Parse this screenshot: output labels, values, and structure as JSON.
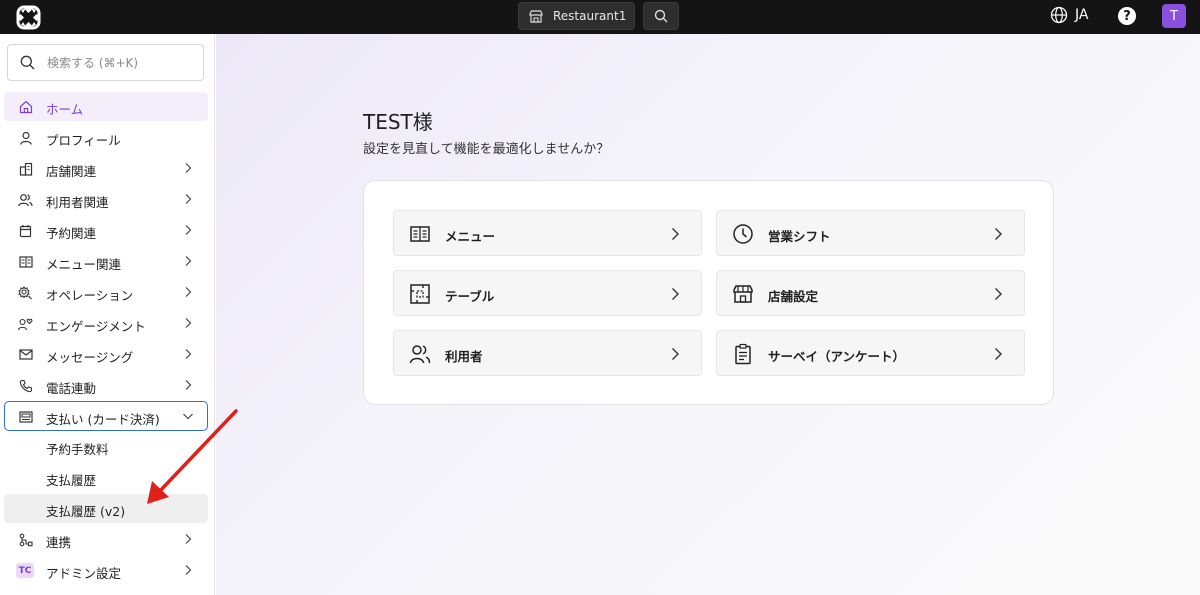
{
  "topbar": {
    "store_name": "Restaurant1",
    "language": "JA",
    "help_symbol": "?",
    "avatar_initial": "T"
  },
  "sidebar": {
    "search_placeholder": "検索する (⌘+K)",
    "items": [
      {
        "label": "ホーム",
        "icon": "home-icon",
        "chevron": false
      },
      {
        "label": "プロフィール",
        "icon": "person-icon",
        "chevron": false
      },
      {
        "label": "店舗関連",
        "icon": "building-icon",
        "chevron": true
      },
      {
        "label": "利用者関連",
        "icon": "users-icon",
        "chevron": true
      },
      {
        "label": "予約関連",
        "icon": "calendar-icon",
        "chevron": true
      },
      {
        "label": "メニュー関連",
        "icon": "menu-book-icon",
        "chevron": true
      },
      {
        "label": "オペレーション",
        "icon": "operation-gear-icon",
        "chevron": true
      },
      {
        "label": "エンゲージメント",
        "icon": "engagement-heart-icon",
        "chevron": true
      },
      {
        "label": "メッセージング",
        "icon": "mail-icon",
        "chevron": true
      },
      {
        "label": "電話連動",
        "icon": "phone-icon",
        "chevron": true
      },
      {
        "label": "支払い (カード決済)",
        "icon": "payment-terminal-icon",
        "chevron": "down"
      },
      {
        "label": "予約手数料",
        "sub": true
      },
      {
        "label": "支払履歴",
        "sub": true
      },
      {
        "label": "支払履歴 (v2)",
        "sub": true
      },
      {
        "label": "連携",
        "icon": "integration-icon",
        "chevron": true
      },
      {
        "label": "アドミン設定",
        "icon": "tc-badge",
        "chevron": true
      }
    ],
    "tc_badge_text": "TC"
  },
  "main": {
    "greeting": "TEST様",
    "subtitle": "設定を見直して機能を最適化しませんか？",
    "tiles": [
      {
        "label": "メニュー",
        "icon": "menu-book-icon"
      },
      {
        "label": "営業シフト",
        "icon": "clock-icon"
      },
      {
        "label": "テーブル",
        "icon": "table-icon"
      },
      {
        "label": "店舗設定",
        "icon": "storefront-icon"
      },
      {
        "label": "利用者",
        "icon": "users-icon"
      },
      {
        "label": "サーベイ（アンケート）",
        "icon": "clipboard-icon"
      }
    ]
  },
  "colors": {
    "topbar_bg": "#141414",
    "accent": "#7a3fd0",
    "avatar_bg": "#8b4fe0",
    "focus_border": "#2f6fd6",
    "annotation_arrow": "#e0201a"
  }
}
